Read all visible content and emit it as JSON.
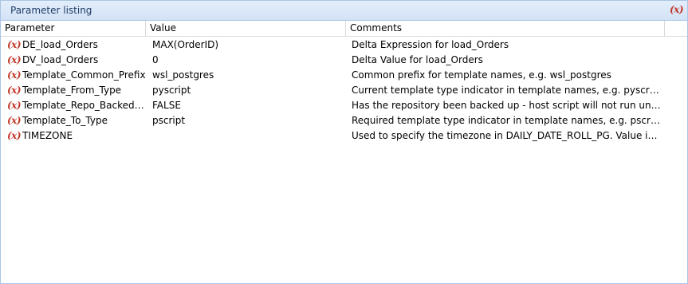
{
  "panel": {
    "title": "Parameter listing",
    "close_icon_text": "(x)"
  },
  "columns": {
    "parameter": "Parameter",
    "value": "Value",
    "comments": "Comments"
  },
  "rows": [
    {
      "icon": "(x)",
      "parameter": "DE_load_Orders",
      "value": "MAX(OrderID)",
      "comment": "Delta Expression for load_Orders"
    },
    {
      "icon": "(x)",
      "parameter": "DV_load_Orders",
      "value": "0",
      "comment": "Delta Value for load_Orders"
    },
    {
      "icon": "(x)",
      "parameter": "Template_Common_Prefix",
      "value": "wsl_postgres",
      "comment": "Common prefix for template names, e.g. wsl_postgres"
    },
    {
      "icon": "(x)",
      "parameter": "Template_From_Type",
      "value": "pyscript",
      "comment": "Current template type indicator in template names, e.g. pyscript"
    },
    {
      "icon": "(x)",
      "parameter": "Template_Repo_Backed_Up",
      "value": "FALSE",
      "comment": "Has the repository been backed up - host script will not run until this val..."
    },
    {
      "icon": "(x)",
      "parameter": "Template_To_Type",
      "value": "pscript",
      "comment": "Required template type indicator in template names, e.g. pscript"
    },
    {
      "icon": "(x)",
      "parameter": "TIMEZONE",
      "value": "",
      "comment": "Used to specify the timezone in DAILY_DATE_ROLL_PG.  Value is either e..."
    }
  ]
}
